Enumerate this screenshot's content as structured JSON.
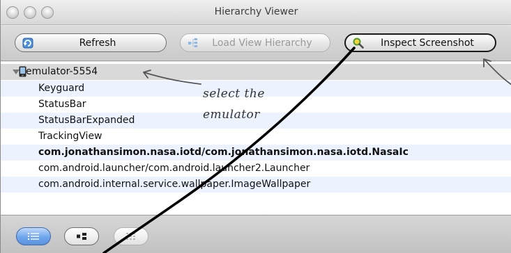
{
  "window": {
    "title": "Hierarchy Viewer"
  },
  "toolbar": {
    "refresh_label": "Refresh",
    "load_label": "Load View Hierarchy",
    "inspect_label": "Inspect Screenshot"
  },
  "device": {
    "name": "emulator-5554"
  },
  "windows_list": [
    {
      "label": "Keyguard"
    },
    {
      "label": "StatusBar"
    },
    {
      "label": "StatusBarExpanded"
    },
    {
      "label": "TrackingView"
    },
    {
      "label": "com.jonathansimon.nasa.iotd/com.jonathansimon.nasa.iotd.NasaIc"
    },
    {
      "label": "com.android.launcher/com.android.launcher2.Launcher"
    },
    {
      "label": "com.android.internal.service.wallpaper.ImageWallpaper"
    }
  ],
  "annotation": {
    "line1": "select the",
    "line2": "emulator"
  },
  "colors": {
    "selection_blue": "#5a92dd",
    "alt_row": "#edf3fe",
    "root_row": "#d9d9d9"
  }
}
